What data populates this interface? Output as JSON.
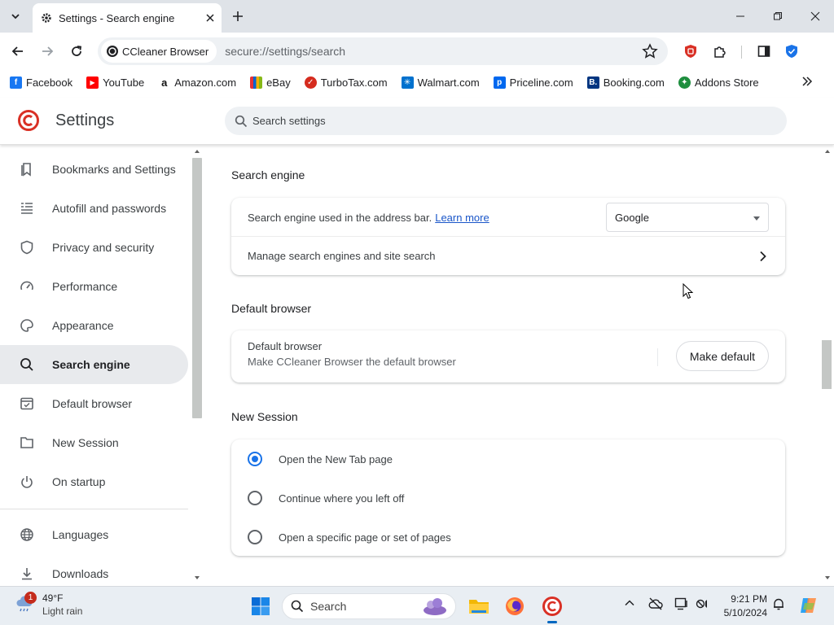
{
  "browser": {
    "tab_title": "Settings - Search engine",
    "site_chip": "CCleaner Browser",
    "url": "secure://settings/search"
  },
  "bookmarks": [
    {
      "label": "Facebook",
      "icon": "facebook-icon",
      "color": "#1877f2"
    },
    {
      "label": "YouTube",
      "icon": "youtube-icon",
      "color": "#ff0000"
    },
    {
      "label": "Amazon.com",
      "icon": "amazon-icon",
      "color": "#111111"
    },
    {
      "label": "eBay",
      "icon": "ebay-icon",
      "color": "#e53238"
    },
    {
      "label": "TurboTax.com",
      "icon": "turbotax-icon",
      "color": "#d52b1e"
    },
    {
      "label": "Walmart.com",
      "icon": "walmart-icon",
      "color": "#0071ce"
    },
    {
      "label": "Priceline.com",
      "icon": "priceline-icon",
      "color": "#0068ef"
    },
    {
      "label": "Booking.com",
      "icon": "booking-icon",
      "color": "#003580"
    },
    {
      "label": "Addons Store",
      "icon": "addons-store-icon",
      "color": "#1e8e3e"
    }
  ],
  "settings": {
    "title": "Settings",
    "search_placeholder": "Search settings"
  },
  "sidebar": {
    "items": [
      {
        "label": "Bookmarks and Settings",
        "icon": "bookmarks-icon"
      },
      {
        "label": "Autofill and passwords",
        "icon": "autofill-icon"
      },
      {
        "label": "Privacy and security",
        "icon": "shield-icon"
      },
      {
        "label": "Performance",
        "icon": "speedometer-icon"
      },
      {
        "label": "Appearance",
        "icon": "palette-icon"
      },
      {
        "label": "Search engine",
        "icon": "search-icon",
        "active": true
      },
      {
        "label": "Default browser",
        "icon": "browser-window-icon"
      },
      {
        "label": "New Session",
        "icon": "new-session-icon"
      },
      {
        "label": "On startup",
        "icon": "power-icon"
      },
      {
        "label": "Languages",
        "icon": "globe-icon"
      },
      {
        "label": "Downloads",
        "icon": "download-icon"
      }
    ]
  },
  "main": {
    "search_engine": {
      "section_title": "Search engine",
      "address_bar_label": "Search engine used in the address bar.",
      "learn_more": "Learn more",
      "selected_engine": "Google",
      "manage_label": "Manage search engines and site search"
    },
    "default_browser": {
      "section_title": "Default browser",
      "title": "Default browser",
      "subtitle": "Make CCleaner Browser the default browser",
      "button": "Make default"
    },
    "new_session": {
      "section_title": "New Session",
      "options": [
        {
          "label": "Open the New Tab page",
          "checked": true
        },
        {
          "label": "Continue where you left off",
          "checked": false
        },
        {
          "label": "Open a specific page or set of pages",
          "checked": false
        }
      ]
    }
  },
  "taskbar": {
    "weather_temp": "49°F",
    "weather_cond": "Light rain",
    "weather_badge": "1",
    "search_placeholder": "Search",
    "time": "9:21 PM",
    "date": "5/10/2024"
  },
  "colors": {
    "accent": "#1a73e8",
    "link": "#1a56c9",
    "brand_red": "#d93025"
  }
}
